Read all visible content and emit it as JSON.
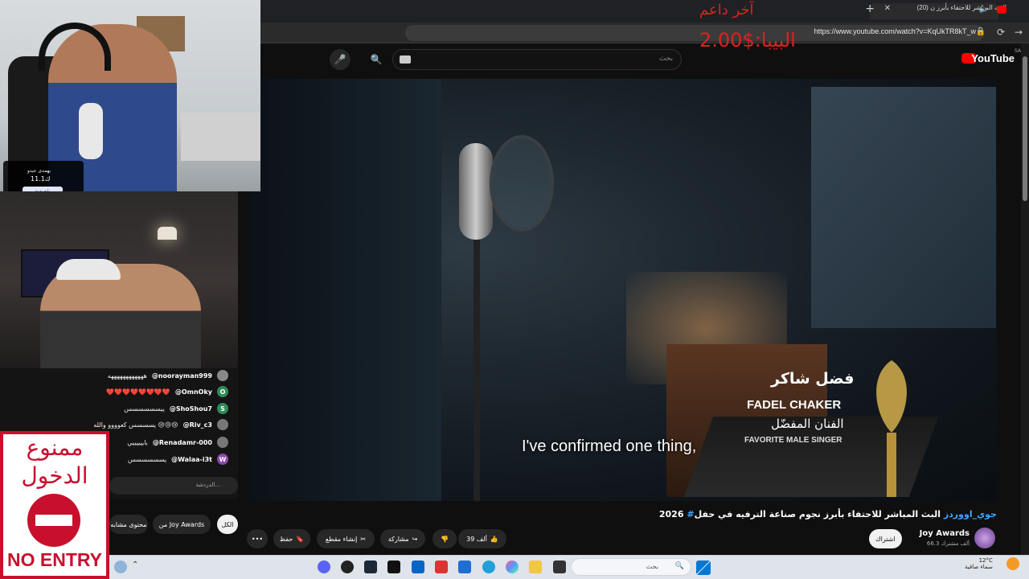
{
  "browser": {
    "tab_title": "(20) البث المباشر للاحتفاء بأبرز ن",
    "url": "https://www.youtube.com/watch?v=KqUkTR8kT_w"
  },
  "youtube": {
    "logo_text": "YouTube",
    "logo_region": "SA",
    "search_placeholder": "بحث",
    "video": {
      "caption": "I've confirmed one thing,",
      "award_name_ar": "فضل شاكر",
      "award_name_en": "FADEL CHAKER",
      "award_category_ar": "الفنان المفضّل",
      "award_category_en": "FAVORITE MALE SINGER"
    },
    "title_main": "البث المباشر للاحتفاء بأبرز نجوم صناعة الترفيه في حفل",
    "title_hashtag": "#جوي_اووردز",
    "title_year": "2026",
    "channel": {
      "name": "Joy Awards",
      "subscribers": "66.3 ألف مشترك",
      "subscribe_label": "اشتراك"
    },
    "actions": {
      "likes": "39 ألف",
      "share": "مشاركة",
      "clip": "إنشاء مقطع",
      "save": "حفظ"
    },
    "chips": {
      "from_channel": "من Joy Awards",
      "similar": "محتوى مشابه",
      "all": "الكل"
    }
  },
  "donation": {
    "line1": "آخر داعم",
    "line2": "2.00$:البيبا"
  },
  "streamer_badge": {
    "name": "بهمدى عبدو",
    "count": "11.1ك",
    "follow": "تابع بقوة"
  },
  "chat": {
    "messages": [
      {
        "user": "@noorayman999",
        "text": "ههههههههههههه",
        "avatar": "",
        "color": "#888"
      },
      {
        "user": "@OmnOky",
        "text": "❤️❤️❤️❤️❤️❤️❤️❤️",
        "avatar": "O",
        "color": "#2e8b57"
      },
      {
        "user": "@ShoShou7",
        "text": "ييسسسسسس",
        "avatar": "S",
        "color": "#2e8b57"
      },
      {
        "user": "@Riv_c3",
        "text": "يسسسس كعوووو والله 😢😢😢",
        "avatar": "",
        "color": "#777"
      },
      {
        "user": "@Renadamr-000",
        "text": "باييييييي",
        "avatar": "",
        "color": "#777"
      },
      {
        "user": "@Walaa-i3t",
        "text": "يسسسسسس",
        "avatar": "W",
        "color": "#8e44ad"
      }
    ],
    "input_placeholder": "الدردشة..."
  },
  "no_entry_sign": {
    "line1": "ممنوع",
    "line2": "الدخول",
    "english": "NO ENTRY"
  },
  "taskbar": {
    "search_placeholder": "بحث",
    "temp": "12°C",
    "weather": "سماء صافية"
  }
}
